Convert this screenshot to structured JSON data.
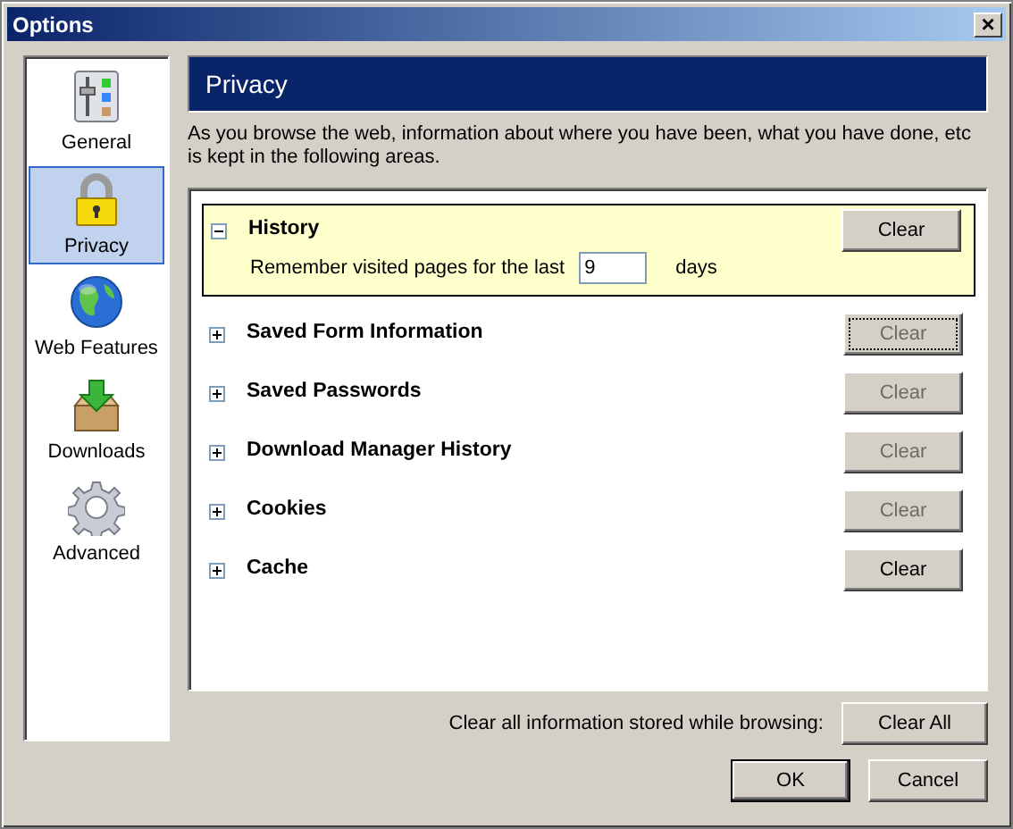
{
  "window": {
    "title": "Options",
    "close": "×"
  },
  "sidebar": {
    "items": [
      {
        "label": "General",
        "kind": "general",
        "selected": false
      },
      {
        "label": "Privacy",
        "kind": "lock",
        "selected": true
      },
      {
        "label": "Web Features",
        "kind": "globe",
        "selected": false
      },
      {
        "label": "Downloads",
        "kind": "download",
        "selected": false
      },
      {
        "label": "Advanced",
        "kind": "gear",
        "selected": false
      }
    ]
  },
  "header": {
    "title": "Privacy"
  },
  "description": "As you browse the web, information about where you have been, what you have done, etc is kept in the following areas.",
  "sections": [
    {
      "label": "History",
      "expanded": true,
      "button": "Clear",
      "disabled": false,
      "focused": false,
      "detail": {
        "before": "Remember visited pages for the last",
        "value": "9",
        "after": "days"
      }
    },
    {
      "label": "Saved Form Information",
      "expanded": false,
      "button": "Clear",
      "disabled": true,
      "focused": true
    },
    {
      "label": "Saved Passwords",
      "expanded": false,
      "button": "Clear",
      "disabled": true,
      "focused": false
    },
    {
      "label": "Download Manager History",
      "expanded": false,
      "button": "Clear",
      "disabled": true,
      "focused": false
    },
    {
      "label": "Cookies",
      "expanded": false,
      "button": "Clear",
      "disabled": true,
      "focused": false
    },
    {
      "label": "Cache",
      "expanded": false,
      "button": "Clear",
      "disabled": false,
      "focused": false
    }
  ],
  "clear_all": {
    "label": "Clear all information stored while browsing:",
    "button": "Clear All"
  },
  "buttons": [
    {
      "label": "OK",
      "default": true
    },
    {
      "label": "Cancel",
      "default": false
    }
  ]
}
